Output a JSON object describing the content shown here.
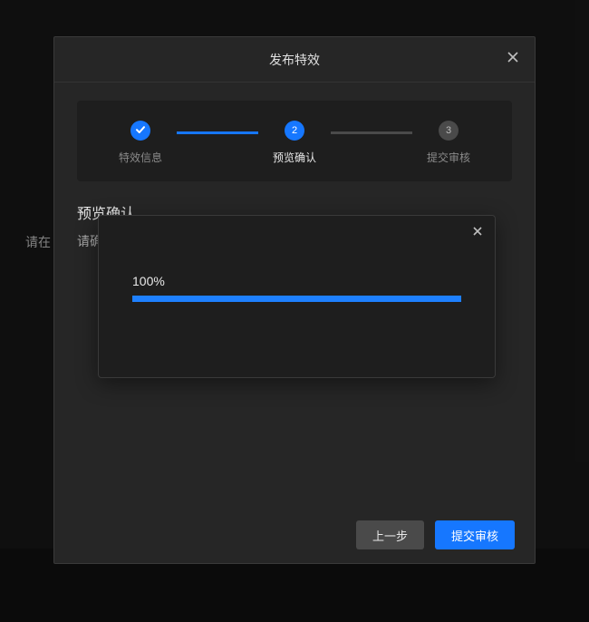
{
  "backdrop": {
    "truncated_text": "请在"
  },
  "modal": {
    "title": "发布特效",
    "stepper": {
      "step1": {
        "label": "特效信息"
      },
      "step2": {
        "number": "2",
        "label": "预览确认"
      },
      "step3": {
        "number": "3",
        "label": "提交审核"
      }
    },
    "section": {
      "title": "预览确认",
      "subtext": "请确"
    },
    "footer": {
      "prev": "上一步",
      "submit": "提交审核"
    }
  },
  "progress": {
    "percent_label": "100%",
    "percent": 100
  }
}
